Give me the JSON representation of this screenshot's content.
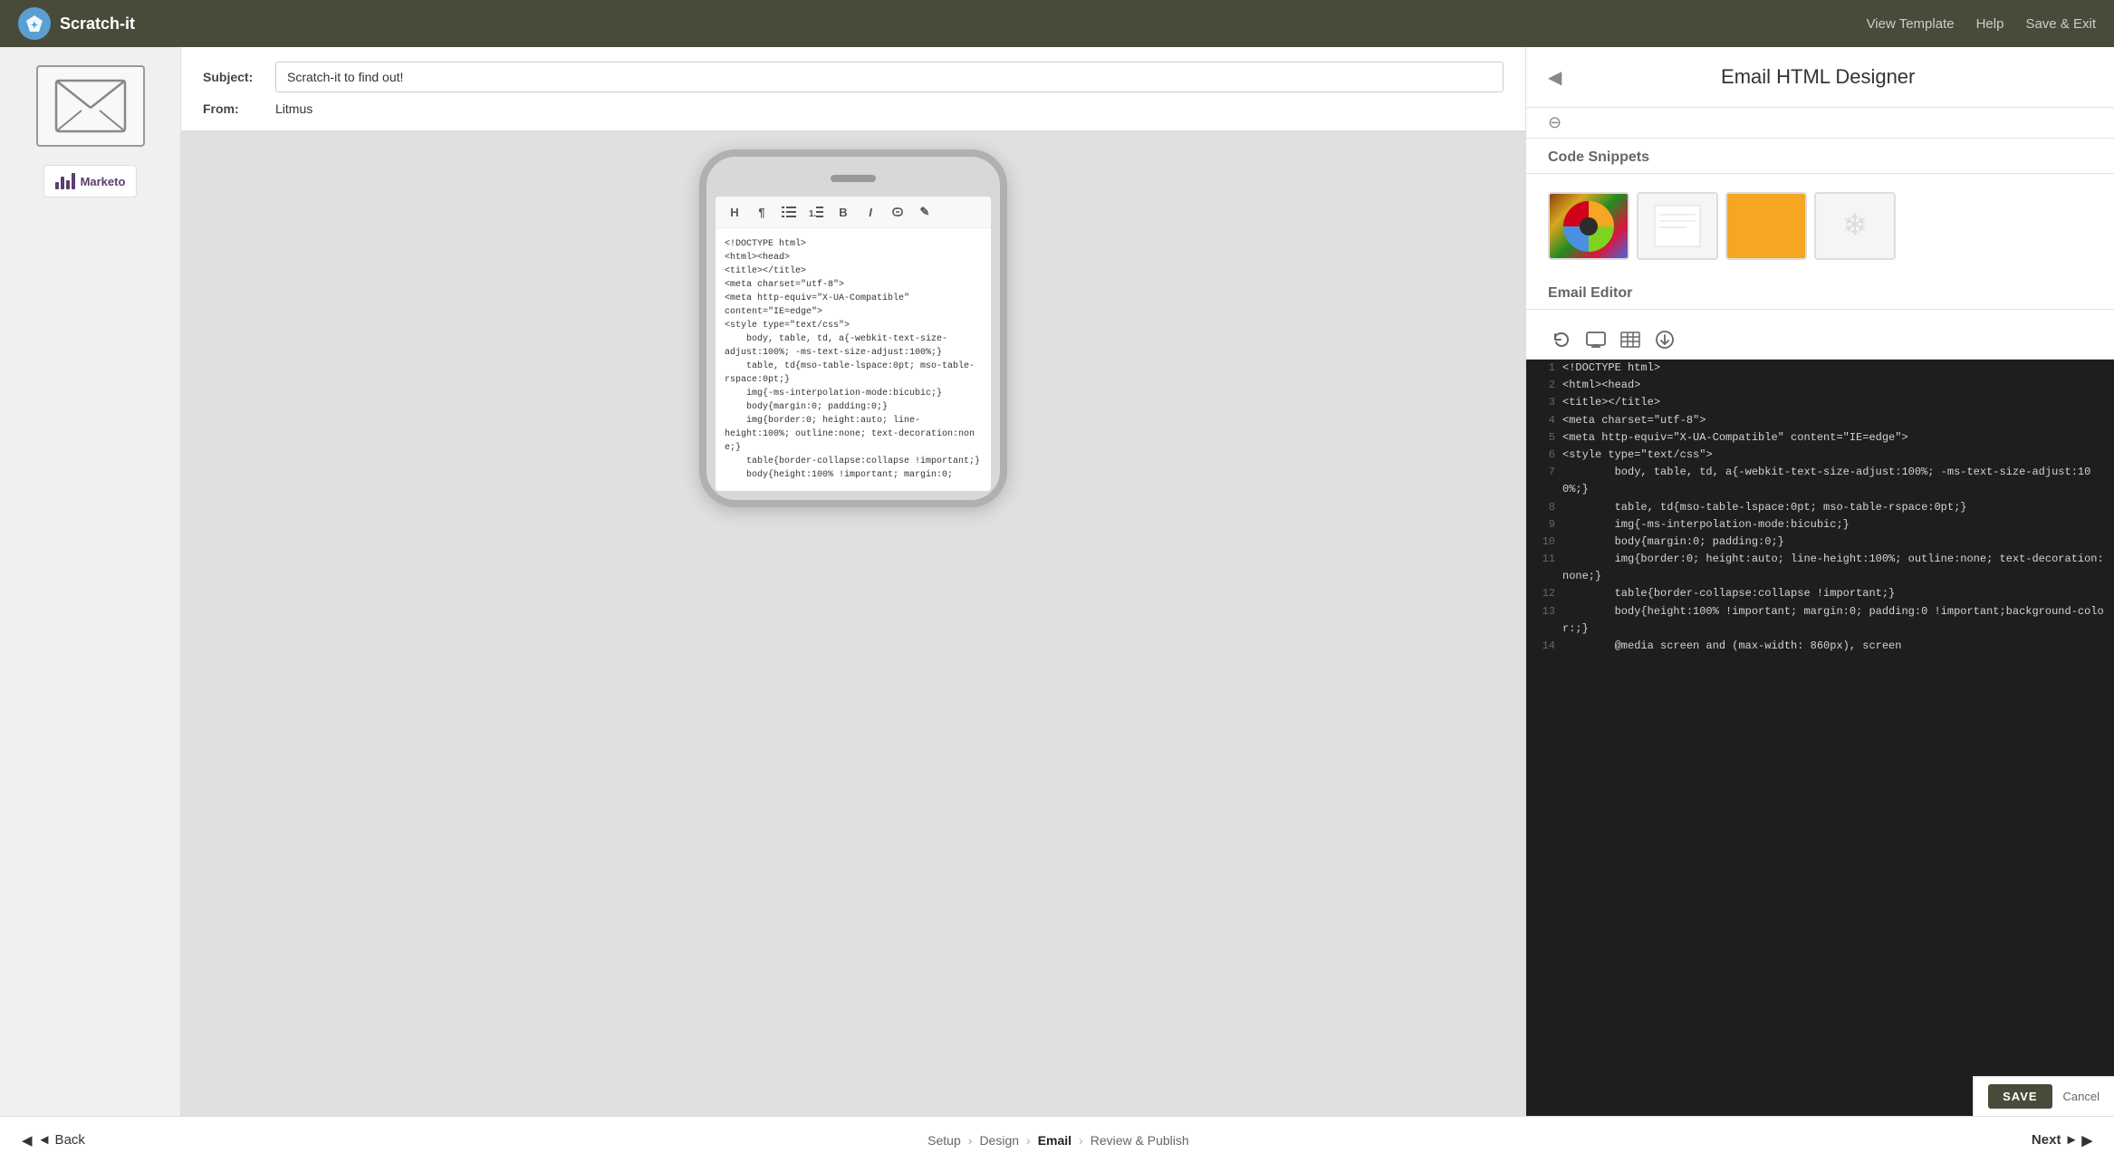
{
  "app": {
    "name": "Scratch-it"
  },
  "topnav": {
    "view_template": "View Template",
    "help": "Help",
    "save_exit": "Save & Exit"
  },
  "email_meta": {
    "subject_label": "Subject:",
    "subject_value": "Scratch-it to find out!",
    "from_label": "From:",
    "from_value": "Litmus"
  },
  "toolbar": {
    "h": "H",
    "p": "¶",
    "ul": "≡",
    "ol": "≡",
    "b": "B",
    "i": "I",
    "link": "🔗",
    "pencil": "✎"
  },
  "right_panel": {
    "title": "Email HTML Designer",
    "code_snippets_label": "Code Snippets",
    "email_editor_label": "Email Editor"
  },
  "code_lines": [
    {
      "num": 1,
      "text": "<!DOCTYPE html>"
    },
    {
      "num": 2,
      "text": "<html><head>"
    },
    {
      "num": 3,
      "text": "<title></title>"
    },
    {
      "num": 4,
      "text": "<meta charset=\"utf-8\">"
    },
    {
      "num": 5,
      "text": "<meta http-equiv=\"X-UA-Compatible\" content=\"IE=edge\">"
    },
    {
      "num": 6,
      "text": "<style type=\"text/css\">"
    },
    {
      "num": 7,
      "text": "        body, table, td, a{-webkit-text-size-adjust:100%; -ms-text-size-adjust:100%;}"
    },
    {
      "num": 8,
      "text": "        table, td{mso-table-lspace:0pt; mso-table-rspace:0pt;}"
    },
    {
      "num": 9,
      "text": "        img{-ms-interpolation-mode:bicubic;}"
    },
    {
      "num": 10,
      "text": "        body{margin:0; padding:0;}"
    },
    {
      "num": 11,
      "text": "        img{border:0; height:auto; line-height:100%; outline:none; text-decoration:none;}"
    },
    {
      "num": 12,
      "text": "        table{border-collapse:collapse !important;}"
    },
    {
      "num": 13,
      "text": "        body{height:100% !important; margin:0; padding:0 !important;background-color:;}"
    },
    {
      "num": 14,
      "text": "        @media screen and (max-width: 860px), screen"
    }
  ],
  "html_code": "<!DOCTYPE html>\n<html><head>\n<title></title>\n<meta charset=\"utf-8\">\n<meta http-equiv=\"X-UA-Compatible\"\ncontent=\"IE=edge\">\n<style type=\"text/css\">\n    body, table, td, a{-webkit-text-size-\nadjust:100%; -ms-text-size-adjust:100%;}\n    table, td{mso-table-lspace:0pt; mso-table-\nrspace:0pt;}\n    img{-ms-interpolation-mode:bicubic;}\n    body{margin:0; padding:0;}\n    img{border:0; height:auto; line-\nheight:100%; outline:none; text-decoration:none;}\n    table{border-collapse:collapse !important;}\n    body{height:100% !important; margin:0;",
  "breadcrumb": {
    "back": "◄ Back",
    "setup": "Setup",
    "design": "Design",
    "email": "Email",
    "review": "Review & Publish",
    "next": "Next ►"
  },
  "save_bar": {
    "save": "SAVE",
    "cancel": "Cancel"
  }
}
